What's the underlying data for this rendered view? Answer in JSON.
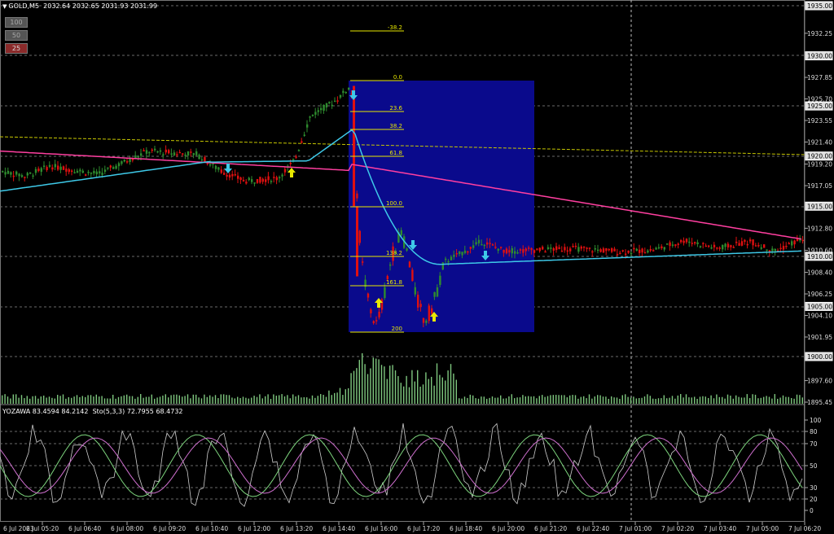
{
  "header": {
    "symbol": "GOLD,M5",
    "ohlc": "2032.64 2032.65 2031.93 2031.99"
  },
  "zoom_buttons": [
    "100",
    "50",
    "25"
  ],
  "oscillator": {
    "label": "YOZAWA 83.4594 84.2142",
    "stoch": "Sto(5,3,3) 72.7955 68.4732",
    "levels": [
      "100",
      "80",
      "70",
      "50",
      "30",
      "20",
      "0"
    ]
  },
  "price_scale": [
    "1935.00",
    "1932.25",
    "1930.00",
    "1927.85",
    "1925.70",
    "1925.00",
    "1923.55",
    "1921.40",
    "1920.00",
    "1919.20",
    "1917.05",
    "1915.00",
    "1912.80",
    "1910.60",
    "1910.00",
    "1908.40",
    "1906.25",
    "1905.00",
    "1904.10",
    "1901.95",
    "1900.00",
    "1897.60",
    "1895.45"
  ],
  "time_labels": [
    "6 Jul 2023",
    "6 Jul 05:20",
    "6 Jul 06:40",
    "6 Jul 08:00",
    "6 Jul 09:20",
    "6 Jul 10:40",
    "6 Jul 12:00",
    "6 Jul 13:20",
    "6 Jul 14:40",
    "6 Jul 16:00",
    "6 Jul 17:20",
    "6 Jul 18:40",
    "6 Jul 20:00",
    "6 Jul 21:20",
    "6 Jul 22:40",
    "7 Jul 01:00",
    "7 Jul 02:20",
    "7 Jul 03:40",
    "7 Jul 05:00",
    "7 Jul 06:20"
  ],
  "fibonacci": [
    "-38.2",
    "0.0",
    "23.6",
    "38.2",
    "61.8",
    "100.0",
    "138.2",
    "161.8",
    "200"
  ],
  "colors": {
    "background": "#000000",
    "bull": "#2e8b2e",
    "bear": "#e01010",
    "fast_ma": "#3ec9e8",
    "slow_ma": "#ff3fa0",
    "fib": "#e8e800",
    "fib_box": "#0a0a8c",
    "volume": "#7ec67e",
    "grid": "#6a6a6a"
  }
}
